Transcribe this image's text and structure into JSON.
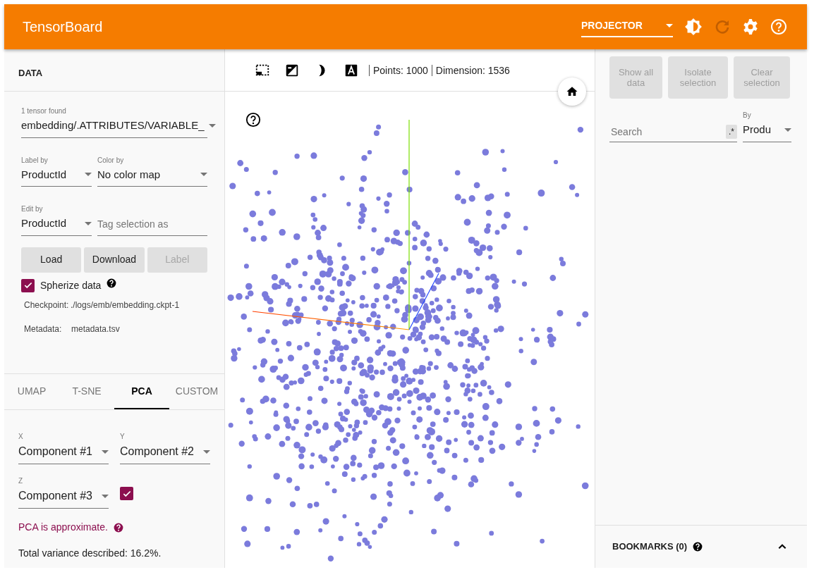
{
  "app_bar": {
    "title": "TensorBoard",
    "dashboard": "PROJECTOR",
    "reload_disabled": true
  },
  "data_panel": {
    "heading": "DATA",
    "tensor": {
      "label": "1 tensor found",
      "value": "embedding/.ATTRIBUTES/VARIABLE_"
    },
    "label_by": {
      "label": "Label by",
      "value": "ProductId"
    },
    "color_by": {
      "label": "Color by",
      "value": "No color map"
    },
    "edit_by": {
      "label": "Edit by",
      "value": "ProductId"
    },
    "tag_field": {
      "placeholder": "Tag selection as"
    },
    "buttons": [
      {
        "label": "Load",
        "disabled": false
      },
      {
        "label": "Download",
        "disabled": false
      },
      {
        "label": "Label",
        "disabled": true
      }
    ],
    "spherize": {
      "label": "Spherize data",
      "checked": true
    },
    "info": [
      {
        "label": "Checkpoint:",
        "value": "./logs/emb/embedding.ckpt-1"
      },
      {
        "label": "Metadata:",
        "value": "metadata.tsv"
      }
    ]
  },
  "projection_tabs": [
    {
      "label": "UMAP",
      "selected": false
    },
    {
      "label": "T-SNE",
      "selected": false
    },
    {
      "label": "PCA",
      "selected": true
    },
    {
      "label": "CUSTOM",
      "selected": false
    }
  ],
  "pca": {
    "axes": [
      {
        "label": "X",
        "value": "Component #1"
      },
      {
        "label": "Y",
        "value": "Component #2"
      },
      {
        "label": "Z",
        "value": "Component #3"
      }
    ],
    "z_enabled": true,
    "note": "PCA is approximate.",
    "variance": "Total variance described: 16.2%."
  },
  "toolbar": {
    "points": "Points: 1000",
    "dimension": "Dimension: 1536"
  },
  "inspector": {
    "buttons": [
      {
        "label": "Show all data",
        "disabled": true
      },
      {
        "label": "Isolate selection",
        "disabled": true
      },
      {
        "label": "Clear selection",
        "disabled": true
      }
    ],
    "search": {
      "placeholder": "Search",
      "regex": ".*"
    },
    "by": {
      "label": "By",
      "value": "Produ"
    }
  },
  "bookmarks": {
    "title": "BOOKMARKS (0)"
  }
}
